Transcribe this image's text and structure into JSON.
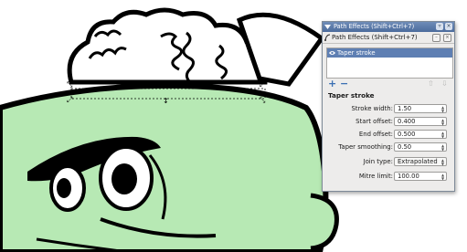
{
  "window": {
    "title": "Path Effects (Shift+Ctrl+7)",
    "tab_label": "Path Effects (Shift+Ctrl+7)"
  },
  "effects_list": {
    "items": [
      {
        "label": "Taper stroke",
        "visible": true,
        "selected": true
      }
    ]
  },
  "list_tools": {
    "add_icon": "plus-icon",
    "remove_icon": "minus-icon",
    "up_icon": "arrow-up-icon",
    "down_icon": "arrow-down-icon"
  },
  "effect_params": {
    "section_title": "Taper stroke",
    "stroke_width": {
      "label": "Stroke width:",
      "value": "1.50"
    },
    "start_offset": {
      "label": "Start offset:",
      "value": "0.400"
    },
    "end_offset": {
      "label": "End offset:",
      "value": "0.500"
    },
    "taper_smoothing": {
      "label": "Taper smoothing:",
      "value": "0.50"
    },
    "join_type": {
      "label": "Join type:",
      "value": "Extrapolated"
    },
    "mitre_limit": {
      "label": "Mitre limit:",
      "value": "100.00"
    }
  },
  "colors": {
    "skin": "#b7e9b4",
    "outline": "#000000",
    "selection": "#5e7fb3",
    "titlebar": "#5677a8"
  }
}
